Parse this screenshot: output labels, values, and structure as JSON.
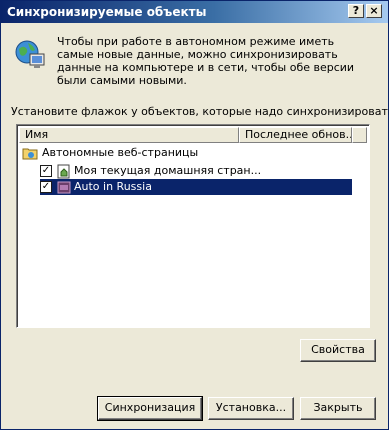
{
  "window": {
    "title": "Синхронизируемые объекты",
    "help_button": "?",
    "close_button": "×"
  },
  "info_text": "Чтобы при работе в автономном режиме иметь самые новые данные, можно синхронизировать данные на компьютере и в сети, чтобы обе версии были самыми новыми.",
  "instruction": "Установите флажок у объектов, которые надо синхронизировать.",
  "list": {
    "columns": [
      "Имя",
      "Последнее обнов..."
    ],
    "group": "Автономные веб-страницы",
    "items": [
      {
        "label": "Моя текущая домашняя стран...",
        "checked": true,
        "selected": false,
        "icon": "home-page-icon"
      },
      {
        "label": "Auto in Russia",
        "checked": true,
        "selected": true,
        "icon": "web-page-icon"
      }
    ]
  },
  "buttons": {
    "properties": "Свойства",
    "synchronize": "Синхронизация",
    "setup": "Установка...",
    "close": "Закрыть"
  },
  "colors": {
    "title_bar": "#0a246a",
    "selection": "#0a246a",
    "dialog_face": "#ece9d8"
  }
}
